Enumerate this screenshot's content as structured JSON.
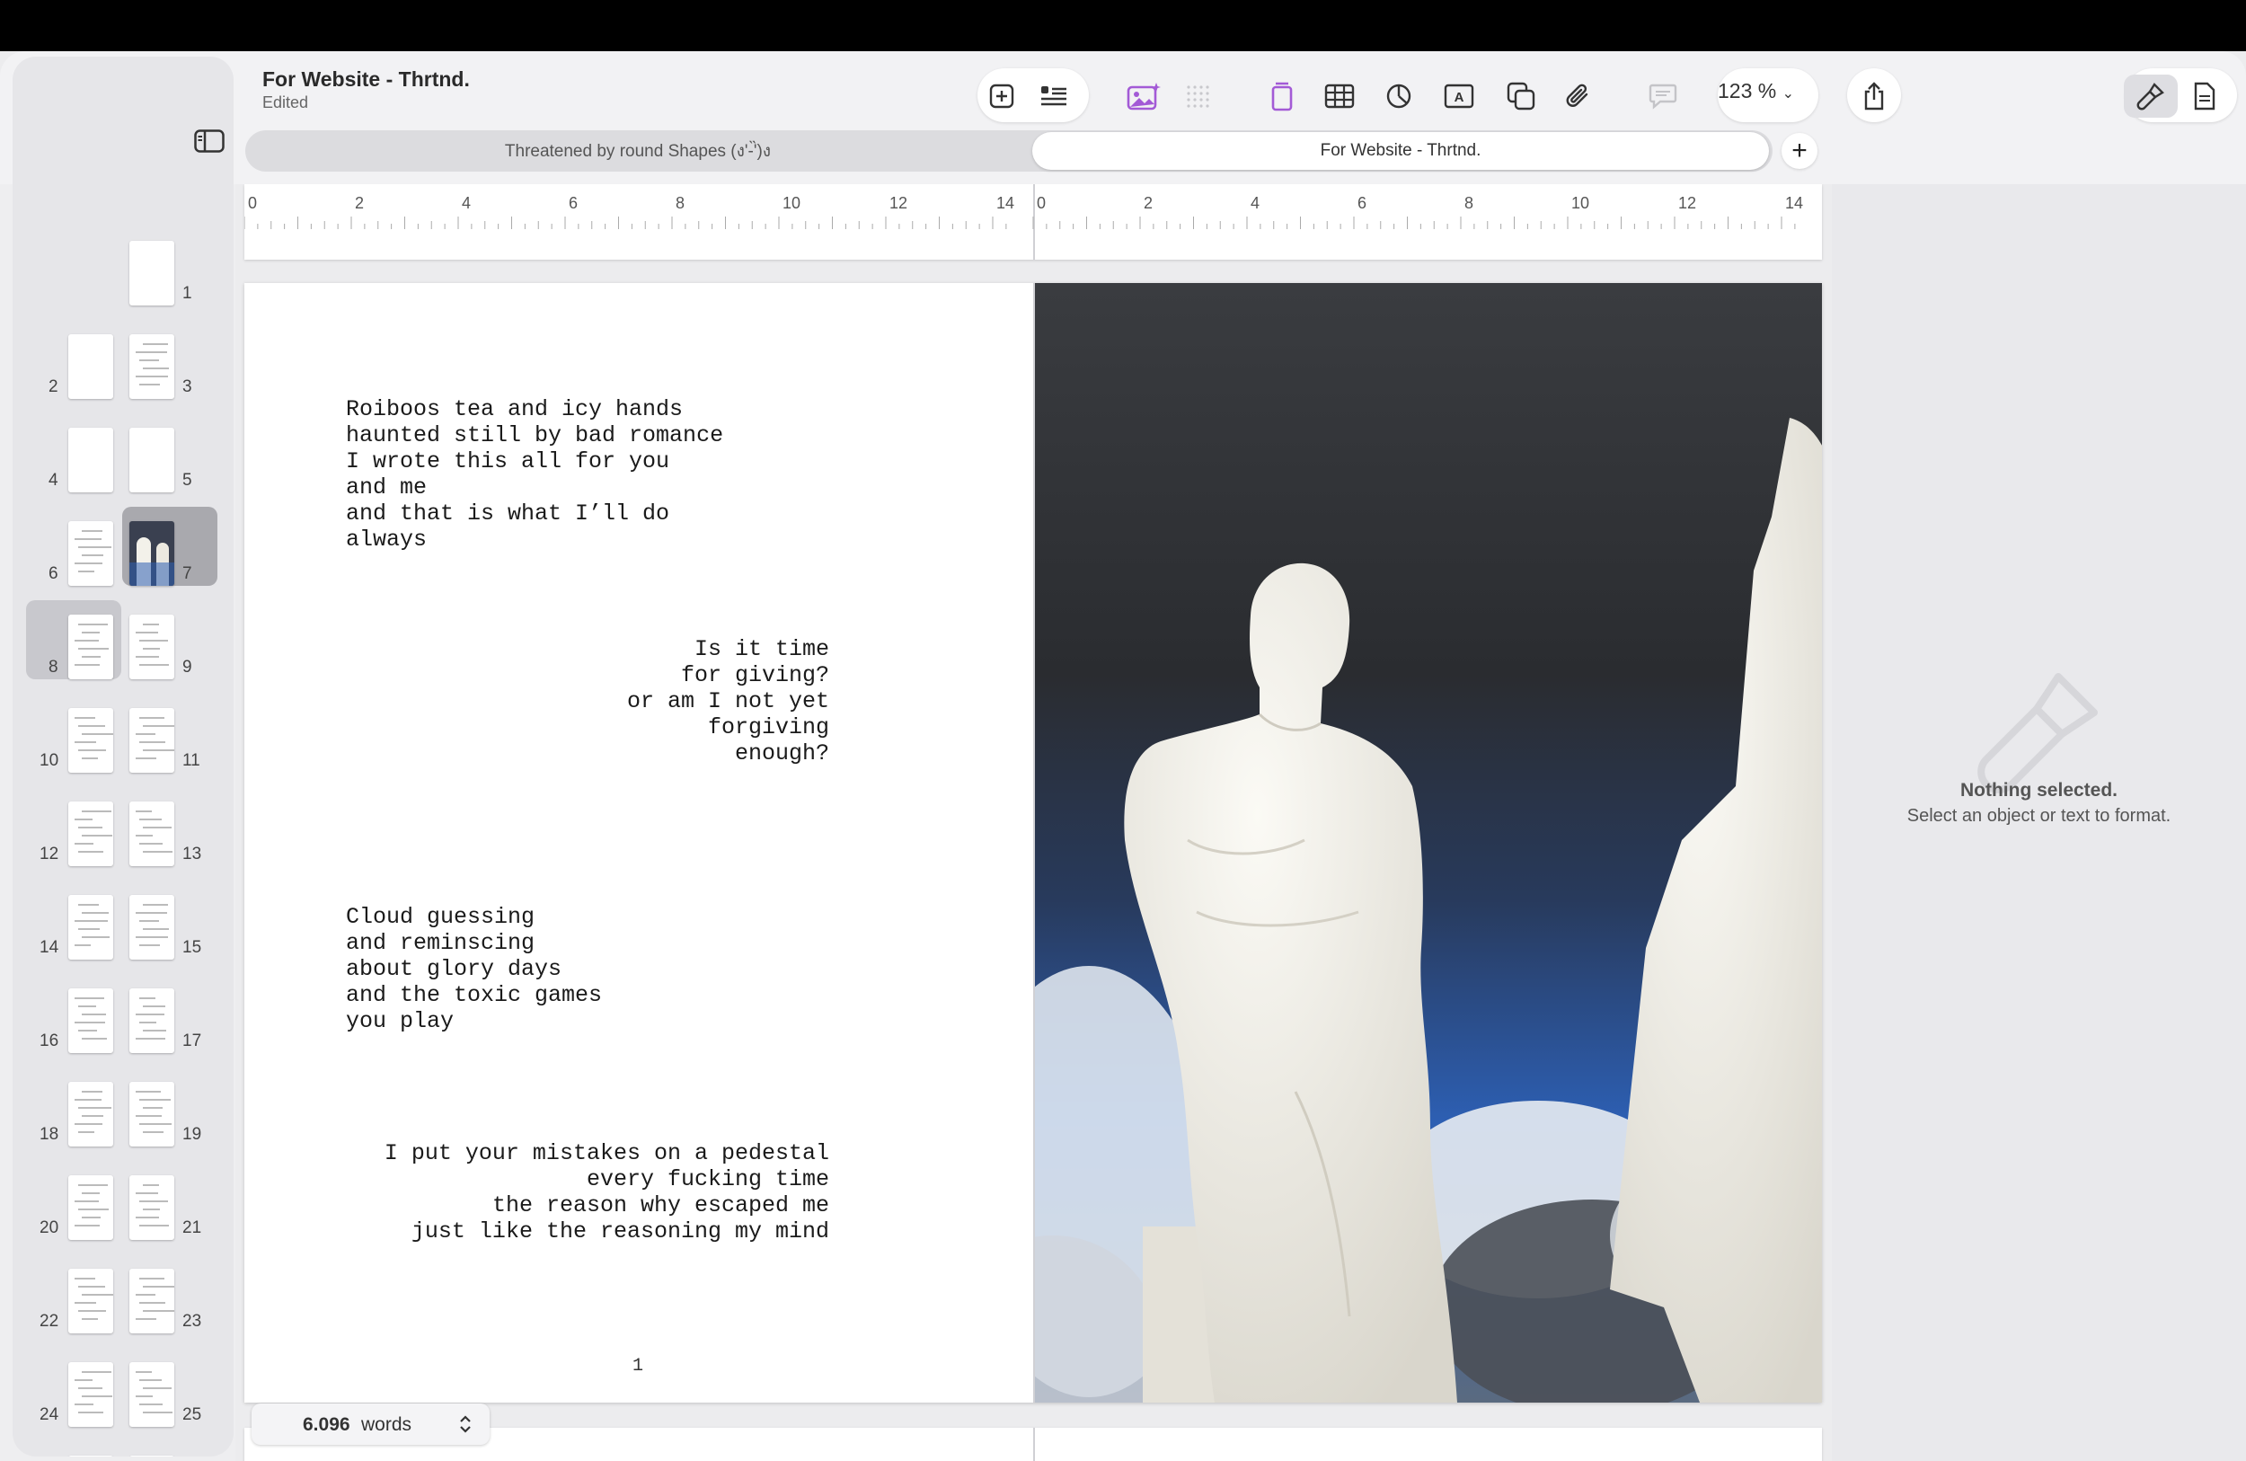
{
  "document": {
    "title": "For Website - Thrtnd.",
    "status": "Edited"
  },
  "toolbar": {
    "zoom": "123 %"
  },
  "tabs": [
    {
      "label": "Threatened by round Shapes (ง'-̀'̀)ง",
      "active": false
    },
    {
      "label": "For Website - Thrtnd.",
      "active": true
    }
  ],
  "ruler_labels": [
    "0",
    "2",
    "4",
    "6",
    "8",
    "10",
    "12",
    "14"
  ],
  "page_thumbs": [
    {
      "num": "1"
    },
    {
      "num": "2"
    },
    {
      "num": "3"
    },
    {
      "num": "4"
    },
    {
      "num": "5"
    },
    {
      "num": "6"
    },
    {
      "num": "7"
    },
    {
      "num": "8"
    },
    {
      "num": "9"
    },
    {
      "num": "10"
    },
    {
      "num": "11"
    },
    {
      "num": "12"
    },
    {
      "num": "13"
    },
    {
      "num": "14"
    },
    {
      "num": "15"
    },
    {
      "num": "16"
    },
    {
      "num": "17"
    },
    {
      "num": "18"
    },
    {
      "num": "19"
    },
    {
      "num": "20"
    },
    {
      "num": "21"
    },
    {
      "num": "22"
    },
    {
      "num": "23"
    },
    {
      "num": "24"
    },
    {
      "num": "25"
    }
  ],
  "poems": {
    "stanza1": "Roiboos tea and icy hands\nhaunted still by bad romance\nI wrote this all for you\nand me\nand that is what I’ll do\nalways",
    "stanza2": "Is it time\nfor giving?\nor am I not yet\nforgiving\nenough?",
    "stanza3": "Cloud guessing\nand reminscing\nabout glory days\nand the toxic games\nyou play",
    "stanza4": "I put your mistakes on a pedestal\nevery fucking time\nthe reason why escaped me\njust like the reasoning my mind"
  },
  "page_number": "1",
  "word_count": {
    "value": "6.096",
    "unit": "words"
  },
  "inspector": {
    "title": "Nothing selected.",
    "subtitle": "Select an object or text to format."
  },
  "colors": {
    "accent": "#a35ad6",
    "sky_dark": "#2d2f33",
    "sky_blue": "#2d5fb3"
  }
}
